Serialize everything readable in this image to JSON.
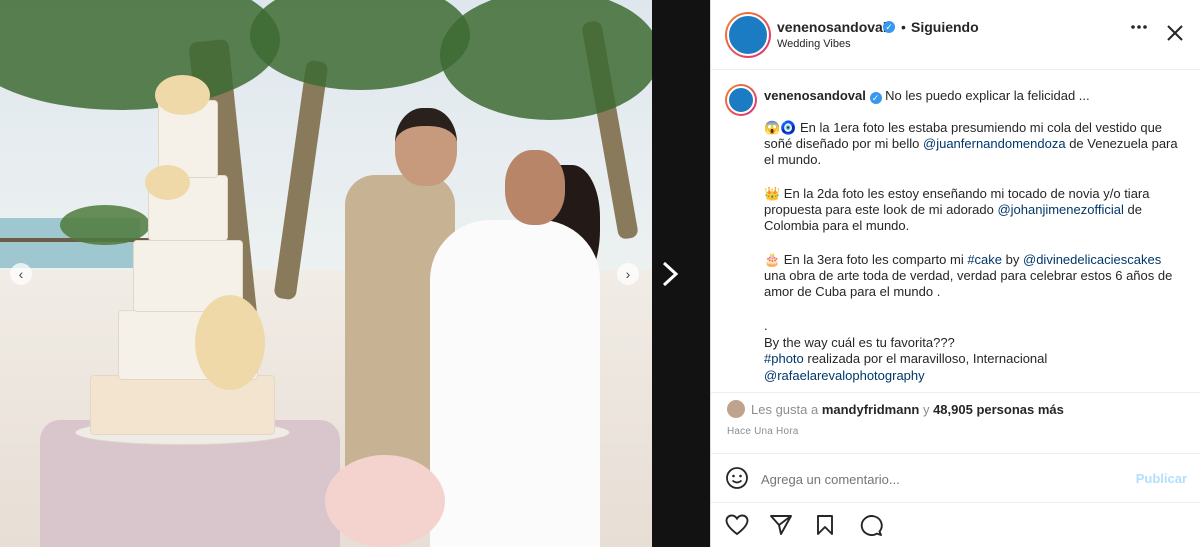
{
  "post": {
    "username": "venenosandoval",
    "follow_status": "Siguiendo",
    "dot": "•",
    "location": "Wedding Vibes",
    "caption_first": "No les puedo explicar la felicidad ...",
    "para1_prefix": "😱🧿 En la 1era foto les estaba presumiendo mi cola del vestido que soñé diseñado por mi bello ",
    "para1_mention": "@juanfernandomendoza",
    "para1_suffix": " de Venezuela para el mundo.",
    "para2_prefix": "👑 En la 2da foto les estoy enseñando mi tocado de novia y/o tiara propuesta para este look de mi adorado ",
    "para2_mention": "@johanjimenezofficial",
    "para2_suffix": " de Colombia para el mundo.",
    "para3_prefix": "🎂 En la 3era foto les comparto mi ",
    "para3_hashtag": "#cake",
    "para3_mid": " by ",
    "para3_mention": "@divinedelicaciescakes",
    "para3_suffix": " una obra de arte toda de verdad, verdad para celebrar estos 6 años de amor de Cuba para el mundo .",
    "dot_line": ".",
    "question": "By the way cuál es tu favorita???",
    "photo_hashtag": "#photo",
    "photo_text": " realizada por el maravilloso, Internacional",
    "photo_mention": "@rafaelarevalophotography",
    "likes_prefix": "Les gusta a ",
    "likes_user": "mandyfridmann",
    "likes_mid": " y ",
    "likes_count": "48,905 personas más",
    "time": "Hace Una Hora",
    "comment_placeholder": "Agrega un comentario...",
    "publish_label": "Publicar"
  },
  "icons": {
    "more": "more-options-icon",
    "close": "close-icon",
    "emoji": "emoji-icon",
    "like": "heart-icon",
    "share": "share-icon",
    "save": "bookmark-icon",
    "comment": "comment-icon",
    "next": "chevron-right-icon",
    "prev": "chevron-left-icon"
  },
  "colors": {
    "link": "#00376b",
    "publish_disabled": "#b2dffc",
    "verified": "#3897f0"
  }
}
